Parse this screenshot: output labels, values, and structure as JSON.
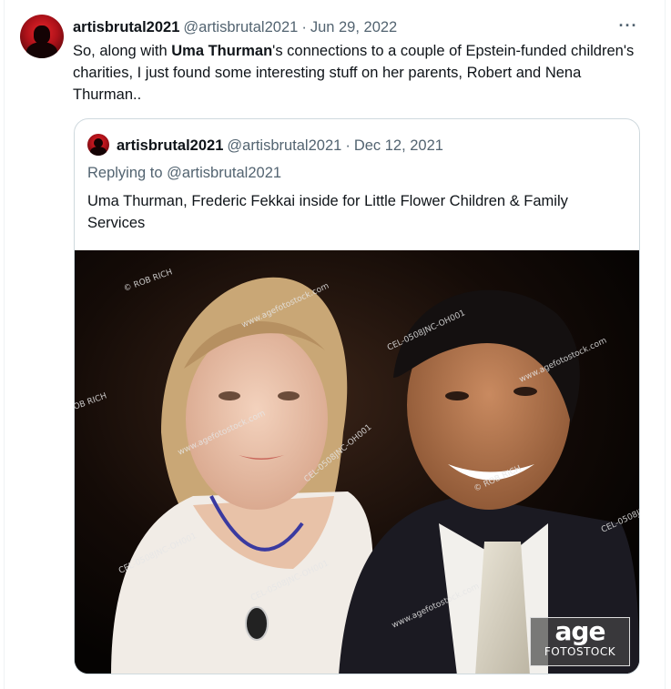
{
  "tweet": {
    "display_name": "artisbrutal2021",
    "handle": "@artisbrutal2021",
    "separator": "·",
    "date": "Jun 29, 2022",
    "more": "···",
    "text_before": "So, along with ",
    "text_bold": "Uma Thurman",
    "text_after": "'s connections to a couple of Epstein-funded children's charities, I just found some interesting stuff on her parents, Robert and Nena Thurman.."
  },
  "quote": {
    "display_name": "artisbrutal2021",
    "handle": "@artisbrutal2021",
    "separator": "·",
    "date": "Dec 12, 2021",
    "replying_label": "Replying to ",
    "replying_handle": "@artisbrutal2021",
    "text": "Uma Thurman, Frederic Fekkai inside for Little Flower Children & Family Services"
  },
  "photo": {
    "watermarks": [
      "© ROB RICH",
      "www.agefotostock.com",
      "CEL-0508JNC-OH001",
      "OB RICH"
    ],
    "logo_big": "age",
    "logo_small": "FOTOSTOCK"
  },
  "colors": {
    "text": "#0f1419",
    "muted": "#536471",
    "border": "#cfd9de"
  }
}
